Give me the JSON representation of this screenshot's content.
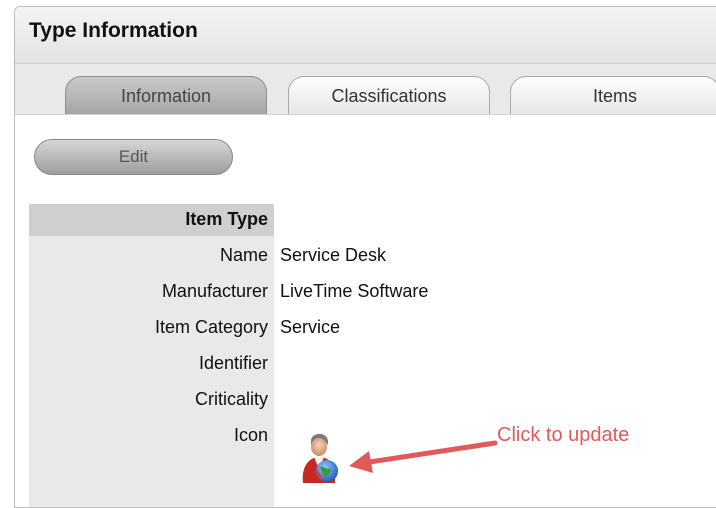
{
  "panel": {
    "title": "Type Information"
  },
  "tabs": [
    {
      "label": "Information",
      "active": true
    },
    {
      "label": "Classifications",
      "active": false
    },
    {
      "label": "Items",
      "active": false
    }
  ],
  "toolbar": {
    "edit_label": "Edit"
  },
  "section": {
    "title": "Item Type"
  },
  "fields": {
    "name": {
      "label": "Name",
      "value": "Service Desk"
    },
    "manufacturer": {
      "label": "Manufacturer",
      "value": "LiveTime Software"
    },
    "item_category": {
      "label": "Item Category",
      "value": "Service"
    },
    "identifier": {
      "label": "Identifier",
      "value": ""
    },
    "criticality": {
      "label": "Criticality",
      "value": ""
    },
    "icon": {
      "label": "Icon",
      "value": "person-with-globe-icon"
    }
  },
  "annotation": {
    "text": "Click to update",
    "color": "#e2595a"
  }
}
